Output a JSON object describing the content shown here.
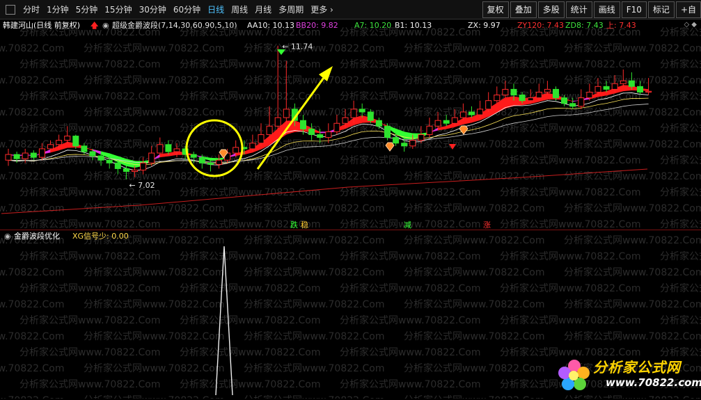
{
  "toolbar": {
    "periods": [
      "分时",
      "1分钟",
      "5分钟",
      "15分钟",
      "30分钟",
      "60分钟",
      "日线",
      "周线",
      "月线",
      "多周期",
      "更多"
    ],
    "active_period": "日线",
    "right_buttons": [
      "复权",
      "叠加",
      "多股",
      "统计",
      "画线",
      "F10",
      "标记",
      "+自"
    ]
  },
  "info": {
    "stock": "韩建河山(日线 前复权)",
    "indicator": "超级金爵波段(7,14,30,60,90,5,10)",
    "aa10": "AA10: 10.13",
    "bb20": "BB20: 9.82",
    "a7": "A7: 10.20",
    "b1": "B1: 10.13",
    "zx": "ZX: 9.97",
    "zy120": "ZY120: 7.43",
    "zd8": "ZD8: 7.43",
    "up": "上: 7.43",
    "corner": "◇ ◆"
  },
  "annotations": {
    "high": "11.74",
    "low": "7.02",
    "signals": [
      "跌",
      "稳",
      "减",
      "涨"
    ]
  },
  "sub": {
    "title": "金爵波段优化",
    "signal": "XG信号少: 0.00"
  },
  "watermark": {
    "text": "分析家公式网www.70822.Com"
  },
  "logo": {
    "name": "分析家公式网",
    "url": "www.70822.com"
  },
  "colors": {
    "up": "#ff2a2a",
    "down": "#2ee32e",
    "ribbon_up": "#ff1a1a",
    "ribbon_down": "#33ff33",
    "ribbon_flat": "#e030e0",
    "accent": "#ffff00",
    "toolbar_active": "#4fc3ff"
  },
  "chart_data": {
    "type": "candlestick",
    "x": [
      1,
      2,
      3,
      4,
      5,
      6,
      7,
      8,
      9,
      10,
      11,
      12,
      13,
      14,
      15,
      16,
      17,
      18,
      19,
      20,
      21,
      22,
      23,
      24,
      25,
      26,
      27,
      28,
      29,
      30,
      31,
      32,
      33,
      34,
      35,
      36,
      37,
      38,
      39,
      40,
      41,
      42,
      43,
      44,
      45,
      46,
      47,
      48,
      49,
      50,
      51,
      52,
      53,
      54,
      55,
      56,
      57,
      58,
      59,
      60,
      61,
      62,
      63,
      64,
      65,
      66,
      67,
      68,
      69,
      70,
      71,
      72,
      73,
      74,
      75,
      76,
      77
    ],
    "open": [
      7.7,
      7.9,
      7.75,
      7.95,
      7.8,
      8.1,
      8.25,
      8.4,
      8.55,
      8.2,
      8.0,
      7.85,
      7.7,
      7.6,
      7.4,
      7.3,
      7.35,
      7.6,
      7.95,
      8.25,
      8.0,
      8.1,
      7.9,
      7.8,
      7.6,
      7.55,
      7.7,
      7.95,
      8.15,
      8.1,
      8.3,
      8.6,
      8.9,
      9.2,
      9.5,
      9.1,
      8.8,
      8.6,
      8.5,
      8.7,
      9.0,
      9.2,
      9.5,
      9.4,
      9.1,
      8.9,
      8.5,
      8.3,
      8.2,
      8.4,
      8.6,
      8.9,
      9.1,
      9.0,
      9.2,
      9.4,
      9.3,
      9.5,
      9.8,
      10.0,
      10.2,
      10.0,
      9.8,
      9.9,
      10.1,
      10.2,
      9.9,
      9.7,
      9.6,
      9.9,
      10.1,
      10.3,
      10.2,
      10.4,
      10.5,
      10.3,
      10.1
    ],
    "close": [
      7.9,
      7.75,
      7.95,
      7.8,
      8.1,
      8.25,
      8.4,
      8.55,
      8.2,
      8.0,
      7.85,
      7.7,
      7.6,
      7.4,
      7.3,
      7.35,
      7.6,
      7.95,
      8.25,
      8.0,
      8.1,
      7.9,
      7.8,
      7.6,
      7.55,
      7.7,
      7.95,
      8.15,
      8.1,
      8.3,
      8.6,
      8.9,
      9.2,
      9.5,
      9.1,
      8.8,
      8.6,
      8.5,
      8.7,
      9.0,
      9.2,
      9.5,
      9.4,
      9.1,
      8.9,
      8.5,
      8.3,
      8.2,
      8.4,
      8.6,
      8.9,
      9.1,
      9.0,
      9.2,
      9.4,
      9.3,
      9.5,
      9.8,
      10.0,
      10.2,
      10.0,
      9.8,
      9.9,
      10.1,
      10.2,
      9.9,
      9.7,
      9.6,
      9.9,
      10.1,
      10.3,
      10.2,
      10.4,
      10.5,
      10.3,
      10.1,
      10.13
    ],
    "high": [
      8.1,
      8.0,
      8.1,
      8.05,
      8.3,
      8.4,
      8.6,
      8.9,
      8.6,
      8.3,
      8.1,
      7.95,
      7.85,
      7.7,
      7.5,
      7.5,
      7.8,
      8.2,
      8.5,
      8.4,
      8.3,
      8.2,
      8.0,
      7.9,
      7.7,
      7.9,
      8.1,
      8.4,
      8.4,
      8.6,
      9.0,
      9.6,
      11.74,
      11.2,
      9.7,
      9.3,
      9.0,
      8.8,
      9.0,
      9.3,
      9.5,
      9.8,
      9.7,
      9.5,
      9.2,
      9.0,
      8.7,
      8.5,
      8.6,
      8.9,
      9.2,
      9.4,
      9.3,
      9.5,
      9.7,
      9.6,
      9.8,
      10.1,
      10.3,
      10.5,
      10.4,
      10.1,
      10.2,
      10.4,
      10.5,
      10.3,
      10.0,
      9.9,
      10.2,
      10.4,
      10.6,
      10.5,
      10.7,
      10.9,
      10.8,
      10.5,
      10.6
    ],
    "low": [
      7.5,
      7.6,
      7.6,
      7.7,
      7.7,
      8.0,
      8.1,
      8.3,
      8.1,
      7.9,
      7.7,
      7.5,
      7.4,
      7.2,
      7.02,
      7.1,
      7.2,
      7.5,
      7.8,
      7.9,
      7.8,
      7.7,
      7.6,
      7.4,
      7.3,
      7.4,
      7.6,
      7.8,
      7.9,
      8.0,
      8.2,
      8.5,
      8.8,
      9.0,
      8.9,
      8.6,
      8.4,
      8.3,
      8.3,
      8.6,
      8.8,
      9.0,
      9.2,
      9.0,
      8.8,
      8.4,
      8.2,
      8.0,
      8.1,
      8.3,
      8.5,
      8.8,
      8.9,
      8.9,
      9.1,
      9.2,
      9.2,
      9.4,
      9.7,
      9.9,
      9.8,
      9.7,
      9.7,
      9.8,
      10.0,
      9.8,
      9.6,
      9.5,
      9.5,
      9.8,
      10.0,
      10.1,
      10.1,
      10.3,
      10.2,
      10.0,
      10.0
    ],
    "ylim": [
      6.6,
      12.1
    ],
    "labels": {
      "max": "11.74",
      "min": "7.02"
    }
  }
}
